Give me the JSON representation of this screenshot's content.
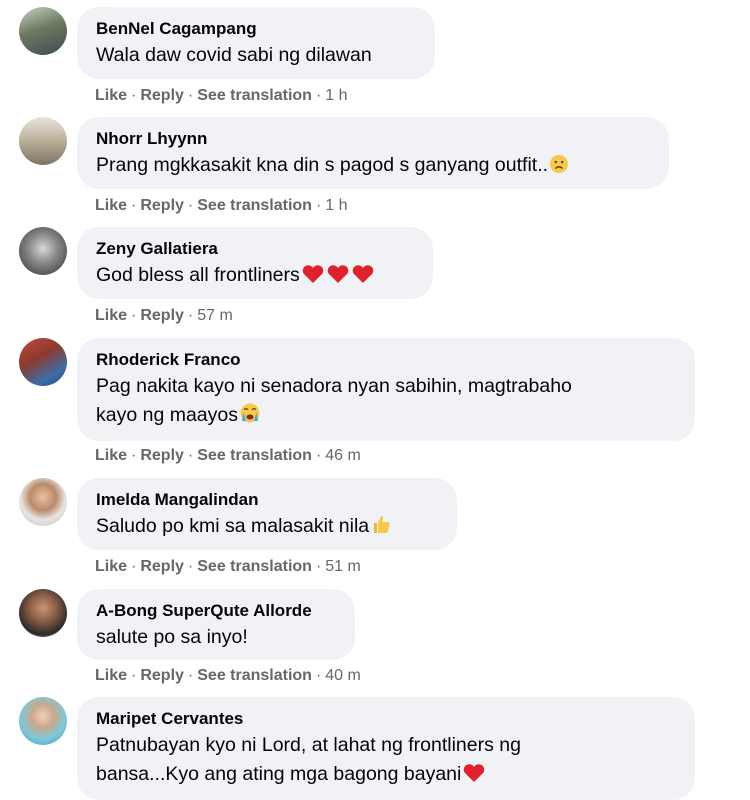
{
  "actions": {
    "like": "Like",
    "reply": "Reply",
    "see_translation": "See translation",
    "sep": "·"
  },
  "comments": [
    {
      "author": "BenNel Cagampang",
      "text": "Wala daw covid sabi ng dilawan",
      "time": "1 h"
    },
    {
      "author": "Nhorr Lhyynn",
      "text": "Prang mgkkasakit kna din s pagod s ganyang outfit..",
      "time": "1 h",
      "emoji": "worried-face-emoji"
    },
    {
      "author": "Zeny Gallatiera",
      "text": "God bless all frontliners",
      "time": "57 m",
      "emoji": "red-heart-emoji"
    },
    {
      "author": "Rhoderick Franco",
      "text_line1": "Pag nakita kayo ni senadora nyan sabihin, magtrabaho",
      "text_line2": "kayo ng maayos",
      "time": "46 m",
      "emoji": "crying-face-emoji"
    },
    {
      "author": "Imelda Mangalindan",
      "text": "Saludo po kmi sa malasakit nila",
      "time": "51 m",
      "emoji": "thumbs-up-emoji"
    },
    {
      "author": "A-Bong SuperQute Allorde",
      "text": "salute po sa inyo!",
      "time": "40 m"
    },
    {
      "author": "Maripet Cervantes",
      "text_line1": "Patnubayan kyo ni Lord, at lahat ng frontliners ng",
      "text_line2": "bansa...Kyo ang ating mga bagong bayani",
      "emoji": "red-heart-emoji"
    }
  ],
  "colors": {
    "bubble": "#f0f2f5",
    "meta": "#65676b",
    "text": "#050505"
  }
}
